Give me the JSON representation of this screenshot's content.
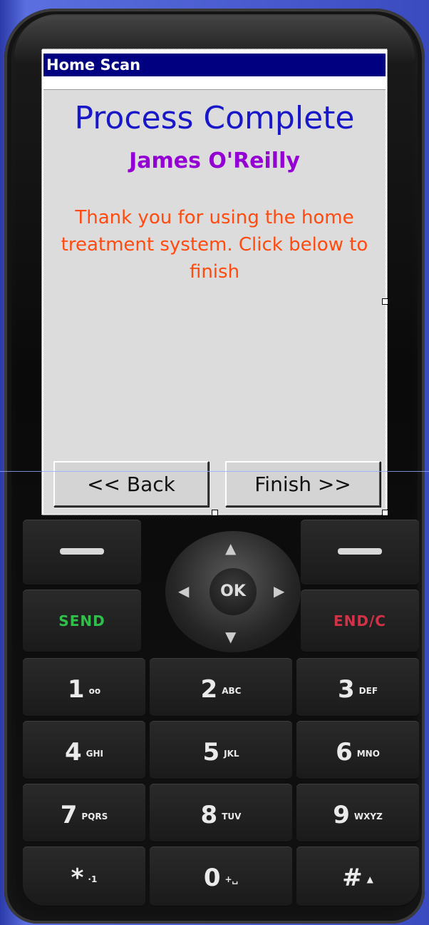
{
  "window": {
    "title": "Home Scan"
  },
  "screen": {
    "heading": "Process Complete",
    "user_name": "James O'Reilly",
    "message": "Thank you for using the home treatment system. Click below to finish"
  },
  "buttons": {
    "back": "<< Back",
    "finish": "Finish >>"
  },
  "phone_keys": {
    "send": "SEND",
    "end": "END/C",
    "ok": "OK",
    "digits": [
      {
        "d": "1",
        "sub": "oo"
      },
      {
        "d": "2",
        "sub": "ABC"
      },
      {
        "d": "3",
        "sub": "DEF"
      },
      {
        "d": "4",
        "sub": "GHI"
      },
      {
        "d": "5",
        "sub": "JKL"
      },
      {
        "d": "6",
        "sub": "MNO"
      },
      {
        "d": "7",
        "sub": "PQRS"
      },
      {
        "d": "8",
        "sub": "TUV"
      },
      {
        "d": "9",
        "sub": "WXYZ"
      },
      {
        "d": "*",
        "sub": "·1"
      },
      {
        "d": "0",
        "sub": "+␣"
      },
      {
        "d": "#",
        "sub": "▲"
      }
    ]
  },
  "colors": {
    "title_bar": "#000080",
    "heading": "#1818c8",
    "user_name": "#9400d3",
    "message": "#ff4a10",
    "send": "#2fbf4a",
    "end": "#d23248"
  }
}
